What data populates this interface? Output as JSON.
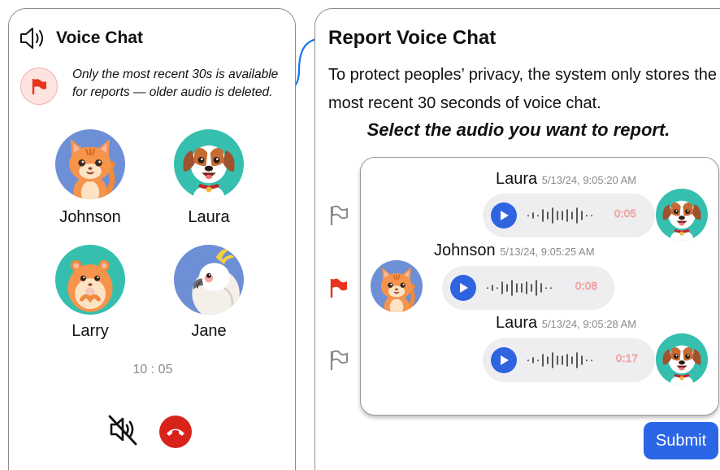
{
  "voice_chat": {
    "title": "Voice Chat",
    "note": "Only the most recent 30s is available for reports — older audio is deleted.",
    "participants": [
      {
        "name": "Johnson",
        "avatar": "cat-avatar"
      },
      {
        "name": "Laura",
        "avatar": "dog-avatar"
      },
      {
        "name": "Larry",
        "avatar": "hamster-avatar"
      },
      {
        "name": "Jane",
        "avatar": "cockatoo-avatar"
      }
    ],
    "timer": "10 : 05",
    "icons": {
      "speaker": "speaker-icon",
      "flag": "flag-icon",
      "mute": "mute-icon",
      "end_call": "end-call-icon"
    }
  },
  "report": {
    "title": "Report Voice Chat",
    "description": "To protect peoples’ privacy, the system only stores the most recent 30 seconds of voice chat.",
    "instruction": "Select the audio you want to report.",
    "messages": [
      {
        "sender": "Laura",
        "timestamp": "5/13/24, 9:05:20 AM",
        "duration": "0:05",
        "flagged": false,
        "avatar": "dog-avatar",
        "side": "right"
      },
      {
        "sender": "Johnson",
        "timestamp": "5/13/24, 9:05:25 AM",
        "duration": "0:08",
        "flagged": true,
        "avatar": "cat-avatar",
        "side": "left"
      },
      {
        "sender": "Laura",
        "timestamp": "5/13/24, 9:05:28 AM",
        "duration": "0:17",
        "flagged": false,
        "avatar": "dog-avatar",
        "side": "right"
      }
    ],
    "submit_label": "Submit"
  },
  "colors": {
    "accent": "#2a66e6",
    "play": "#2f63e0",
    "flag_active": "#e8341c",
    "flag_inactive": "#8a8a8a",
    "end_call": "#d8231b",
    "connector": "#1a73e8"
  }
}
